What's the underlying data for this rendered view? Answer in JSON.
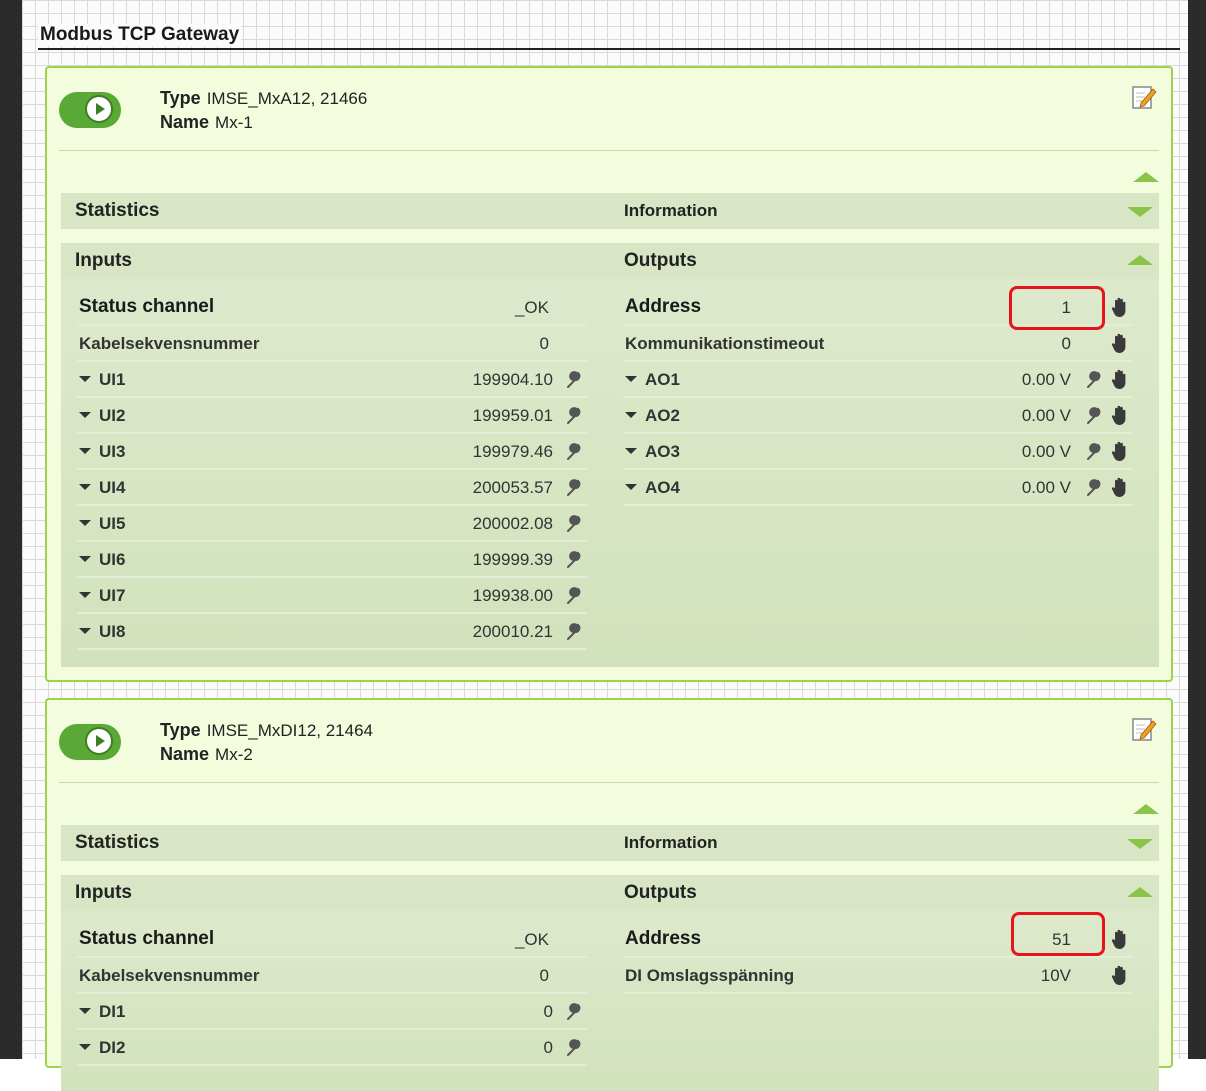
{
  "page": {
    "title": "Modbus TCP Gateway"
  },
  "modules": [
    {
      "type_label": "Type",
      "type_value": "IMSE_MxA12, 21466",
      "name_label": "Name",
      "name_value": "Mx-1",
      "statistics_label": "Statistics",
      "information_label": "Information",
      "inputs_label": "Inputs",
      "outputs_label": "Outputs",
      "inputs": [
        {
          "label": "Status channel",
          "value": "_OK"
        },
        {
          "label": "Kabelsekvensnummer",
          "value": "0"
        },
        {
          "label": "UI1",
          "value": "199904.10"
        },
        {
          "label": "UI2",
          "value": "199959.01"
        },
        {
          "label": "UI3",
          "value": "199979.46"
        },
        {
          "label": "UI4",
          "value": "200053.57"
        },
        {
          "label": "UI5",
          "value": "200002.08"
        },
        {
          "label": "UI6",
          "value": "199999.39"
        },
        {
          "label": "UI7",
          "value": "199938.00"
        },
        {
          "label": "UI8",
          "value": "200010.21"
        }
      ],
      "outputs": [
        {
          "label": "Address",
          "value": "1"
        },
        {
          "label": "Kommunikationstimeout",
          "value": "0"
        },
        {
          "label": "AO1",
          "value": "0.00 V"
        },
        {
          "label": "AO2",
          "value": "0.00 V"
        },
        {
          "label": "AO3",
          "value": "0.00 V"
        },
        {
          "label": "AO4",
          "value": "0.00 V"
        }
      ]
    },
    {
      "type_label": "Type",
      "type_value": "IMSE_MxDI12, 21464",
      "name_label": "Name",
      "name_value": "Mx-2",
      "statistics_label": "Statistics",
      "information_label": "Information",
      "inputs_label": "Inputs",
      "outputs_label": "Outputs",
      "inputs": [
        {
          "label": "Status channel",
          "value": "_OK"
        },
        {
          "label": "Kabelsekvensnummer",
          "value": "0"
        },
        {
          "label": "DI1",
          "value": "0"
        },
        {
          "label": "DI2",
          "value": "0"
        }
      ],
      "outputs": [
        {
          "label": "Address",
          "value": "51"
        },
        {
          "label": "DI Omslagsspänning",
          "value": "10V"
        }
      ]
    }
  ],
  "colors": {
    "accent": "#8bc34a",
    "panel": "#f3fcdd",
    "toggle": "#5aa835",
    "highlight": "#e8141b"
  },
  "icons": [
    "play-toggle-icon",
    "edit-icon",
    "wrench-icon",
    "hand-icon",
    "collapse-arrow-icon",
    "expand-arrow-icon",
    "caret-down-icon"
  ]
}
